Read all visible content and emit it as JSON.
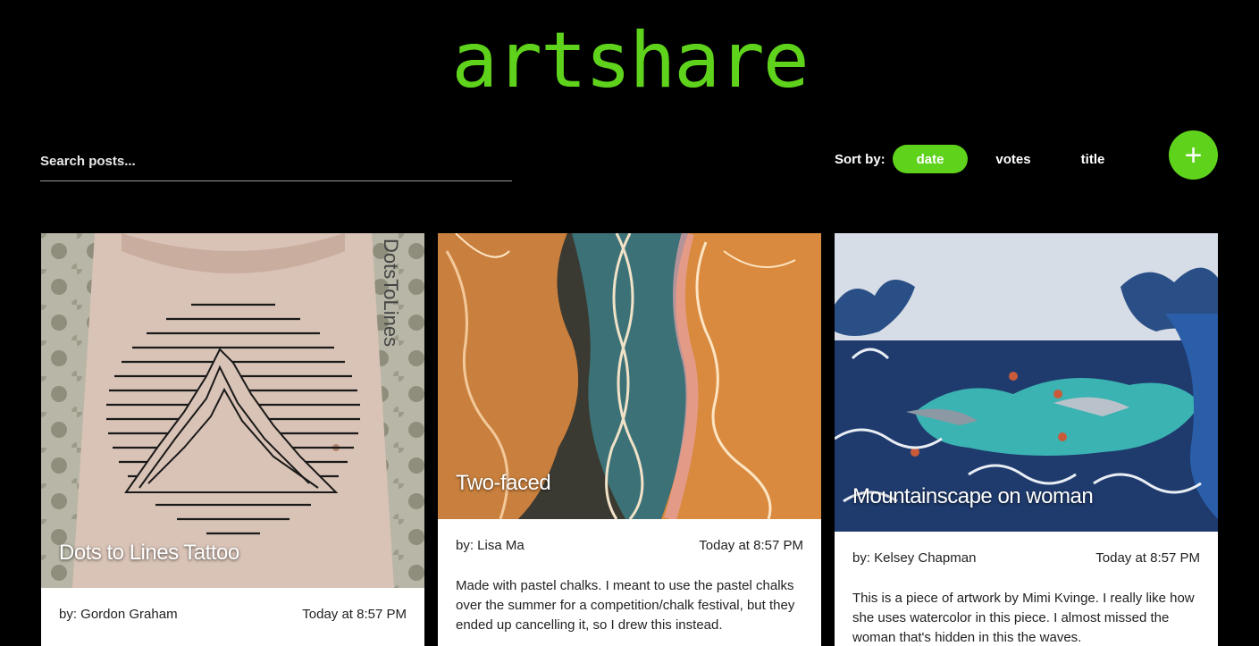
{
  "app": {
    "logo": "artshare"
  },
  "search": {
    "placeholder": "Search posts..."
  },
  "sort": {
    "label": "Sort by:",
    "options": [
      "date",
      "votes",
      "title"
    ],
    "active": "date"
  },
  "add_button": {
    "icon": "plus-icon",
    "glyph": "+"
  },
  "colors": {
    "accent": "#5fd31c",
    "background": "#000000"
  },
  "posts": [
    {
      "title": "Dots to Lines Tattoo",
      "author": "by: Gordon Graham",
      "time": "Today at 8:57 PM",
      "description": "",
      "watermark": "DotsToLines"
    },
    {
      "title": "Two-faced",
      "author": "by: Lisa Ma",
      "time": "Today at 8:57 PM",
      "description": "Made with pastel chalks. I meant to use the pastel chalks over the summer for a competition/chalk festival, but they ended up cancelling it, so I drew this instead."
    },
    {
      "title": "Mountainscape on woman",
      "author": "by: Kelsey Chapman",
      "time": "Today at 8:57 PM",
      "description": "This is a piece of artwork by Mimi Kvinge. I really like how she uses watercolor in this piece. I almost missed the woman that's hidden in this the waves."
    }
  ]
}
